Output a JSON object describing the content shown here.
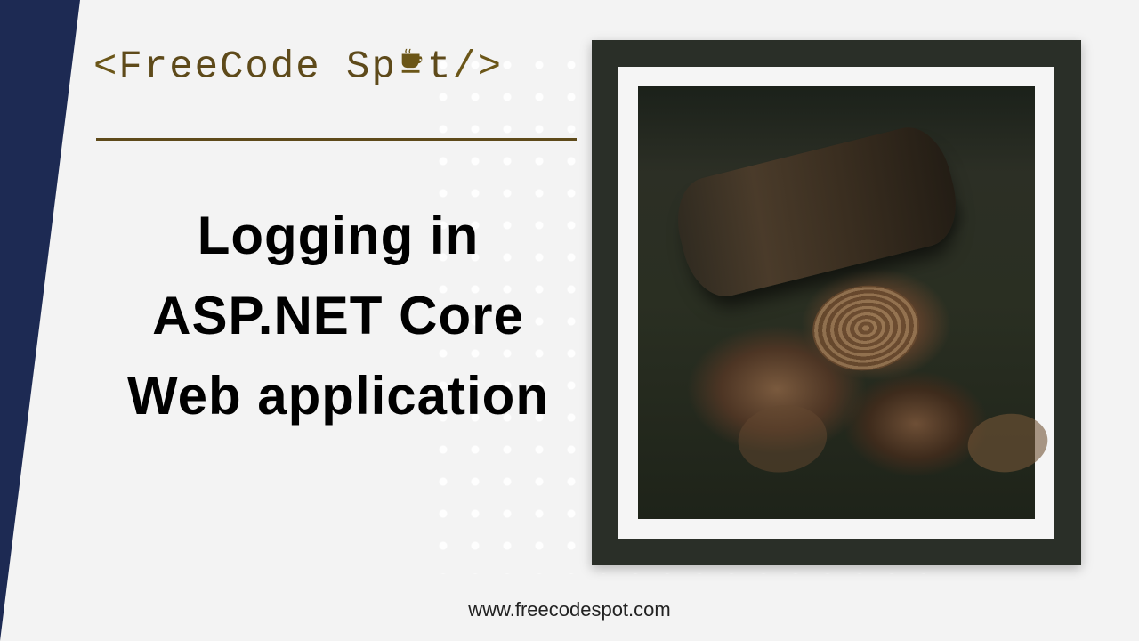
{
  "logo": {
    "open": "<",
    "name_a": "FreeCode",
    "name_b": "Sp",
    "name_c": "t",
    "close": "/>"
  },
  "title": {
    "line1": "Logging in",
    "line2": "ASP.NET Core",
    "line3": "Web application"
  },
  "footer": {
    "url": "www.freecodespot.com"
  },
  "image": {
    "alt": "stack of cut wooden logs in a forest"
  },
  "colors": {
    "navy": "#1d2a53",
    "olive": "#5e4a1a",
    "bg": "#f3f3f3"
  }
}
